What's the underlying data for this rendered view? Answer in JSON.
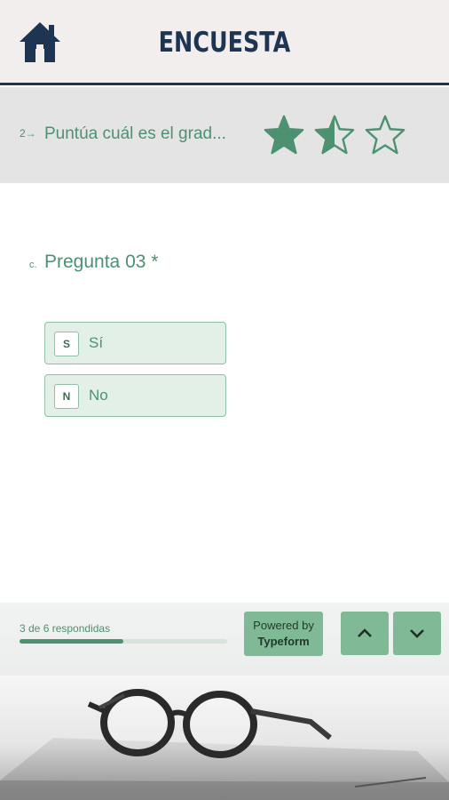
{
  "header": {
    "title": "ENCUESTA",
    "home_icon": "home-icon",
    "title_color": "#1d3553",
    "background": "#f3eeee"
  },
  "previous_question": {
    "number": "2→",
    "text": "Puntúa cuál es el grad...",
    "rating": {
      "value": 1.5,
      "max": 3,
      "color": "#4d9170"
    }
  },
  "question": {
    "letter": "c.",
    "title": "Pregunta 03 *",
    "choices": [
      {
        "key": "S",
        "label": "Sí"
      },
      {
        "key": "N",
        "label": "No"
      }
    ]
  },
  "footer": {
    "progress_text": "3 de 6 respondidas",
    "progress": {
      "answered": 3,
      "total": 6
    },
    "powered_by_line1": "Powered by",
    "powered_by_line2": "Typeform",
    "up_icon": "chevron-up-icon",
    "down_icon": "chevron-down-icon",
    "accent": "#7fb996"
  }
}
